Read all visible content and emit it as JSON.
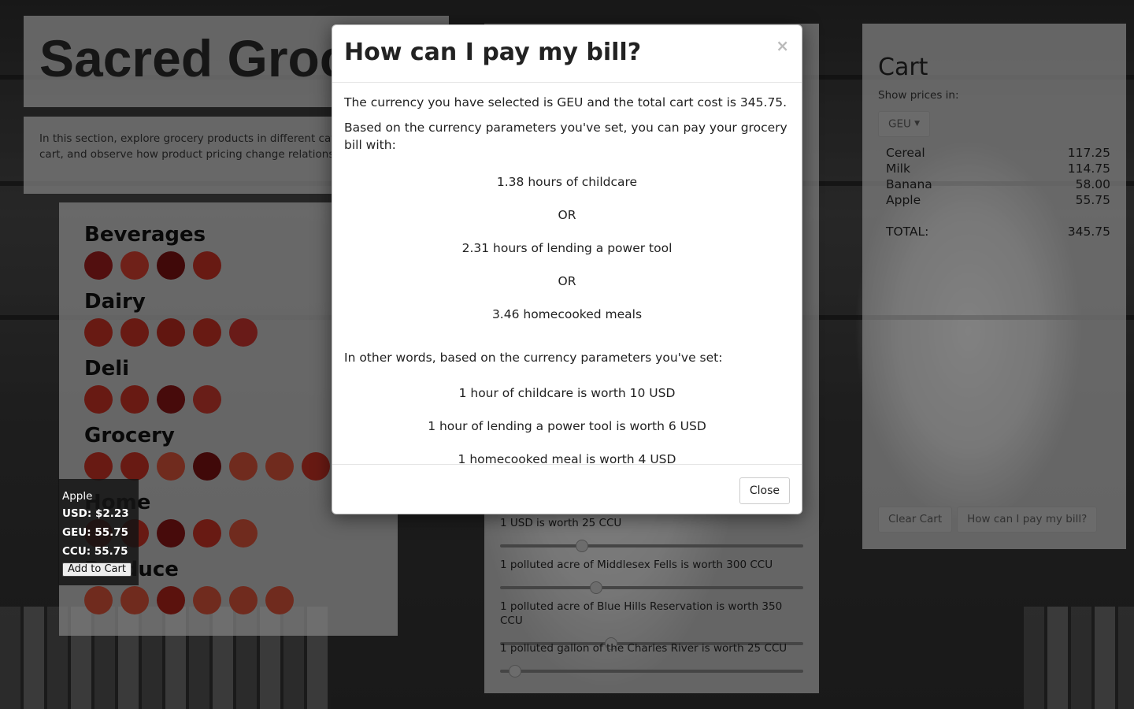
{
  "app": {
    "title": "Sacred Groc"
  },
  "intro": {
    "text": "In this section, explore grocery products in different cate the grocery cart, and observe how product pricing change relationships change."
  },
  "categories": [
    {
      "name": "Beverages",
      "dots": [
        "#8e1b1b",
        "#c0392b",
        "#6e1010",
        "#b32e22"
      ]
    },
    {
      "name": "Dairy",
      "dots": [
        "#b32e22",
        "#b32e22",
        "#a8261c",
        "#b32e22",
        "#b5302a"
      ]
    },
    {
      "name": "Deli",
      "dots": [
        "#b32e22",
        "#b32e22",
        "#7a1414",
        "#b5352a"
      ]
    },
    {
      "name": "Grocery",
      "dots": [
        "#b32e22",
        "#b32e22",
        "#c24a35",
        "#6e1010",
        "#c24a35",
        "#c24a35",
        "#b32e22"
      ]
    },
    {
      "name": "Home",
      "dots": [
        "#b32e22",
        "#b32e22",
        "#7a1414",
        "#b32e22",
        "#c24a35"
      ]
    },
    {
      "name": "Produce",
      "dots": [
        "#c24a35",
        "#c24a35",
        "#9e1f18",
        "#c24a35",
        "#c24a35",
        "#c24a35"
      ]
    }
  ],
  "tooltip": {
    "name": "Apple",
    "usd": "USD: $2.23",
    "geu": "GEU: 55.75",
    "ccu": "CCU: 55.75",
    "button": "Add to Cart"
  },
  "params": [
    {
      "text": "1 USD is worth 25 CCU",
      "value": 0.26
    },
    {
      "text": "1 polluted acre of Middlesex Fells is worth 300 CCU",
      "value": 0.31
    },
    {
      "text": "1 polluted acre of Blue Hills Reservation is worth 350 CCU",
      "value": 0.36
    },
    {
      "text": "1 polluted gallon of the Charles River is worth 25 CCU",
      "value": 0.03
    }
  ],
  "cart": {
    "title": "Cart",
    "show_prices_label": "Show prices in:",
    "currency": "GEU",
    "items": [
      {
        "name": "Cereal",
        "price": "117.25"
      },
      {
        "name": "Milk",
        "price": "114.75"
      },
      {
        "name": "Banana",
        "price": "58.00"
      },
      {
        "name": "Apple",
        "price": "55.75"
      }
    ],
    "total_label": "TOTAL:",
    "total": "345.75",
    "clear_button": "Clear Cart",
    "pay_button": "How can I pay my bill?"
  },
  "modal": {
    "title": "How can I pay my bill?",
    "close_x": "×",
    "summary": "The currency you have selected is GEU and the total cart cost is 345.75.",
    "lead": "Based on the currency parameters you've set, you can pay your grocery bill with:",
    "options": [
      "1.38 hours of childcare",
      "OR",
      "2.31 hours of lending a power tool",
      "OR",
      "3.46 homecooked meals"
    ],
    "other_words": "In other words, based on the currency parameters you've set:",
    "rates": [
      "1 hour of childcare is worth 10 USD",
      "1 hour of lending a power tool is worth 6 USD",
      "1 homecooked meal is worth 4 USD"
    ],
    "close_button": "Close"
  }
}
